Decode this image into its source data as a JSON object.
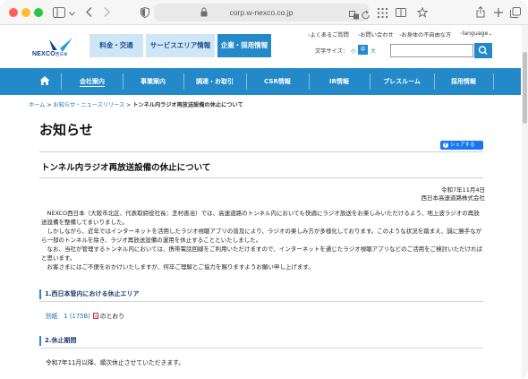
{
  "browser": {
    "url": "corp.w-nexco.co.jp",
    "icons": [
      "sidebar-icon",
      "back-icon",
      "forward-icon",
      "shield-icon",
      "lock-icon",
      "translate-icon",
      "reload-icon",
      "grid-icon",
      "bookmark-icon",
      "star-icon",
      "share-icon",
      "new-tab-icon",
      "tabs-icon"
    ]
  },
  "header": {
    "logo_text": "NEXCO",
    "logo_sub": "西日本",
    "category_tabs": [
      {
        "label": "料金・交通"
      },
      {
        "label": "サービスエリア情報"
      },
      {
        "label": "企業・採用情報"
      }
    ],
    "util_links": [
      "よくあるご質問",
      "お問い合わせ",
      "お身体の不自由な方",
      "language"
    ],
    "font_size_label": "文字サイズ：",
    "font_size_options": [
      "小",
      "中",
      "大"
    ]
  },
  "nav": {
    "items": [
      {
        "label": "会社案内"
      },
      {
        "label": "事業案内"
      },
      {
        "label": "調達・お取引"
      },
      {
        "label": "CSR情報"
      },
      {
        "label": "IR情報"
      },
      {
        "label": "プレスルーム"
      },
      {
        "label": "採用情報"
      }
    ]
  },
  "breadcrumb": {
    "home": "ホーム",
    "sep": " > ",
    "news": "お知らせ・ニュースリリース",
    "current": "トンネル内ラジオ再放送設備の休止について"
  },
  "page": {
    "title": "お知らせ",
    "share_label": "シェアする",
    "article_title": "トンネル内ラジオ再放送設備の休止について",
    "date": "令和7年11月4日",
    "org": "西日本高速道路株式会社",
    "paragraphs": [
      "　NEXCO西日本（大阪市北区、代表取締役社長：芝村善治）では、高速道路のトンネル内においても快適にラジオ放送をお楽しみいただけるよう、地上波ラジオの再放送設備を整備してまいりました。",
      "　しかしながら、近年ではインターネットを活用したラジオ視聴アプリの普及により、ラジオの楽しみ方が多様化しております。このような状況を踏まえ、誠に勝手ながら一部のトンネルを除き、ラジオ再放送設備の運用を休止することといたしました。",
      "　なお、当社が管理するトンネル内においては、携帯電話回線をご利用いただけますので、インターネットを通じたラジオ視聴アプリなどのご活用をご検討いただければと思います。",
      "　お客さまにはご不便をおかけいたしますが、何卒ご理解とご協力を賜りますようお願い申し上げます。"
    ],
    "section1_title": "1.西日本管内における休止エリア",
    "attachment_link": "別紙　1 (175B)",
    "attachment_suffix": "のとおり",
    "section2_title": "2.休止期間",
    "period_text": "令和7年11月以降、順次休止させていただきます。"
  },
  "colors": {
    "brand_blue": "#2389c8",
    "light_tab": "#cfe6f6",
    "link": "#1a6fb3",
    "facebook": "#1877f2"
  }
}
